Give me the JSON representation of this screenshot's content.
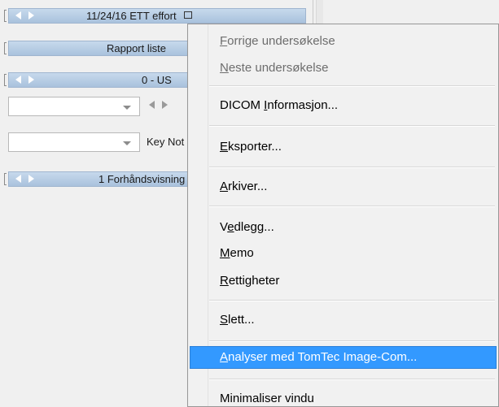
{
  "panel": {
    "bars": [
      {
        "title": "11/24/16 ETT effort"
      },
      {
        "title": "Rapport liste"
      },
      {
        "title": "0 - US"
      },
      {
        "title": "1 Forhåndsvisning"
      }
    ],
    "combo2_label": "Key Not"
  },
  "menu": {
    "items": [
      {
        "pre": "",
        "u": "F",
        "post": "orrige undersøkelse"
      },
      {
        "pre": "",
        "u": "N",
        "post": "este undersøkelse"
      },
      {
        "pre": "DICOM ",
        "u": "I",
        "post": "nformasjon..."
      },
      {
        "pre": "",
        "u": "E",
        "post": "ksporter..."
      },
      {
        "pre": "",
        "u": "A",
        "post": "rkiver..."
      },
      {
        "pre": "V",
        "u": "e",
        "post": "dlegg..."
      },
      {
        "pre": "",
        "u": "M",
        "post": "emo"
      },
      {
        "pre": "",
        "u": "R",
        "post": "ettigheter"
      },
      {
        "pre": "",
        "u": "S",
        "post": "lett..."
      },
      {
        "pre": "",
        "u": "A",
        "post": "nalyser med TomTec Image-Com..."
      },
      {
        "pre": "Minimaliser vindu",
        "u": "",
        "post": ""
      }
    ]
  }
}
